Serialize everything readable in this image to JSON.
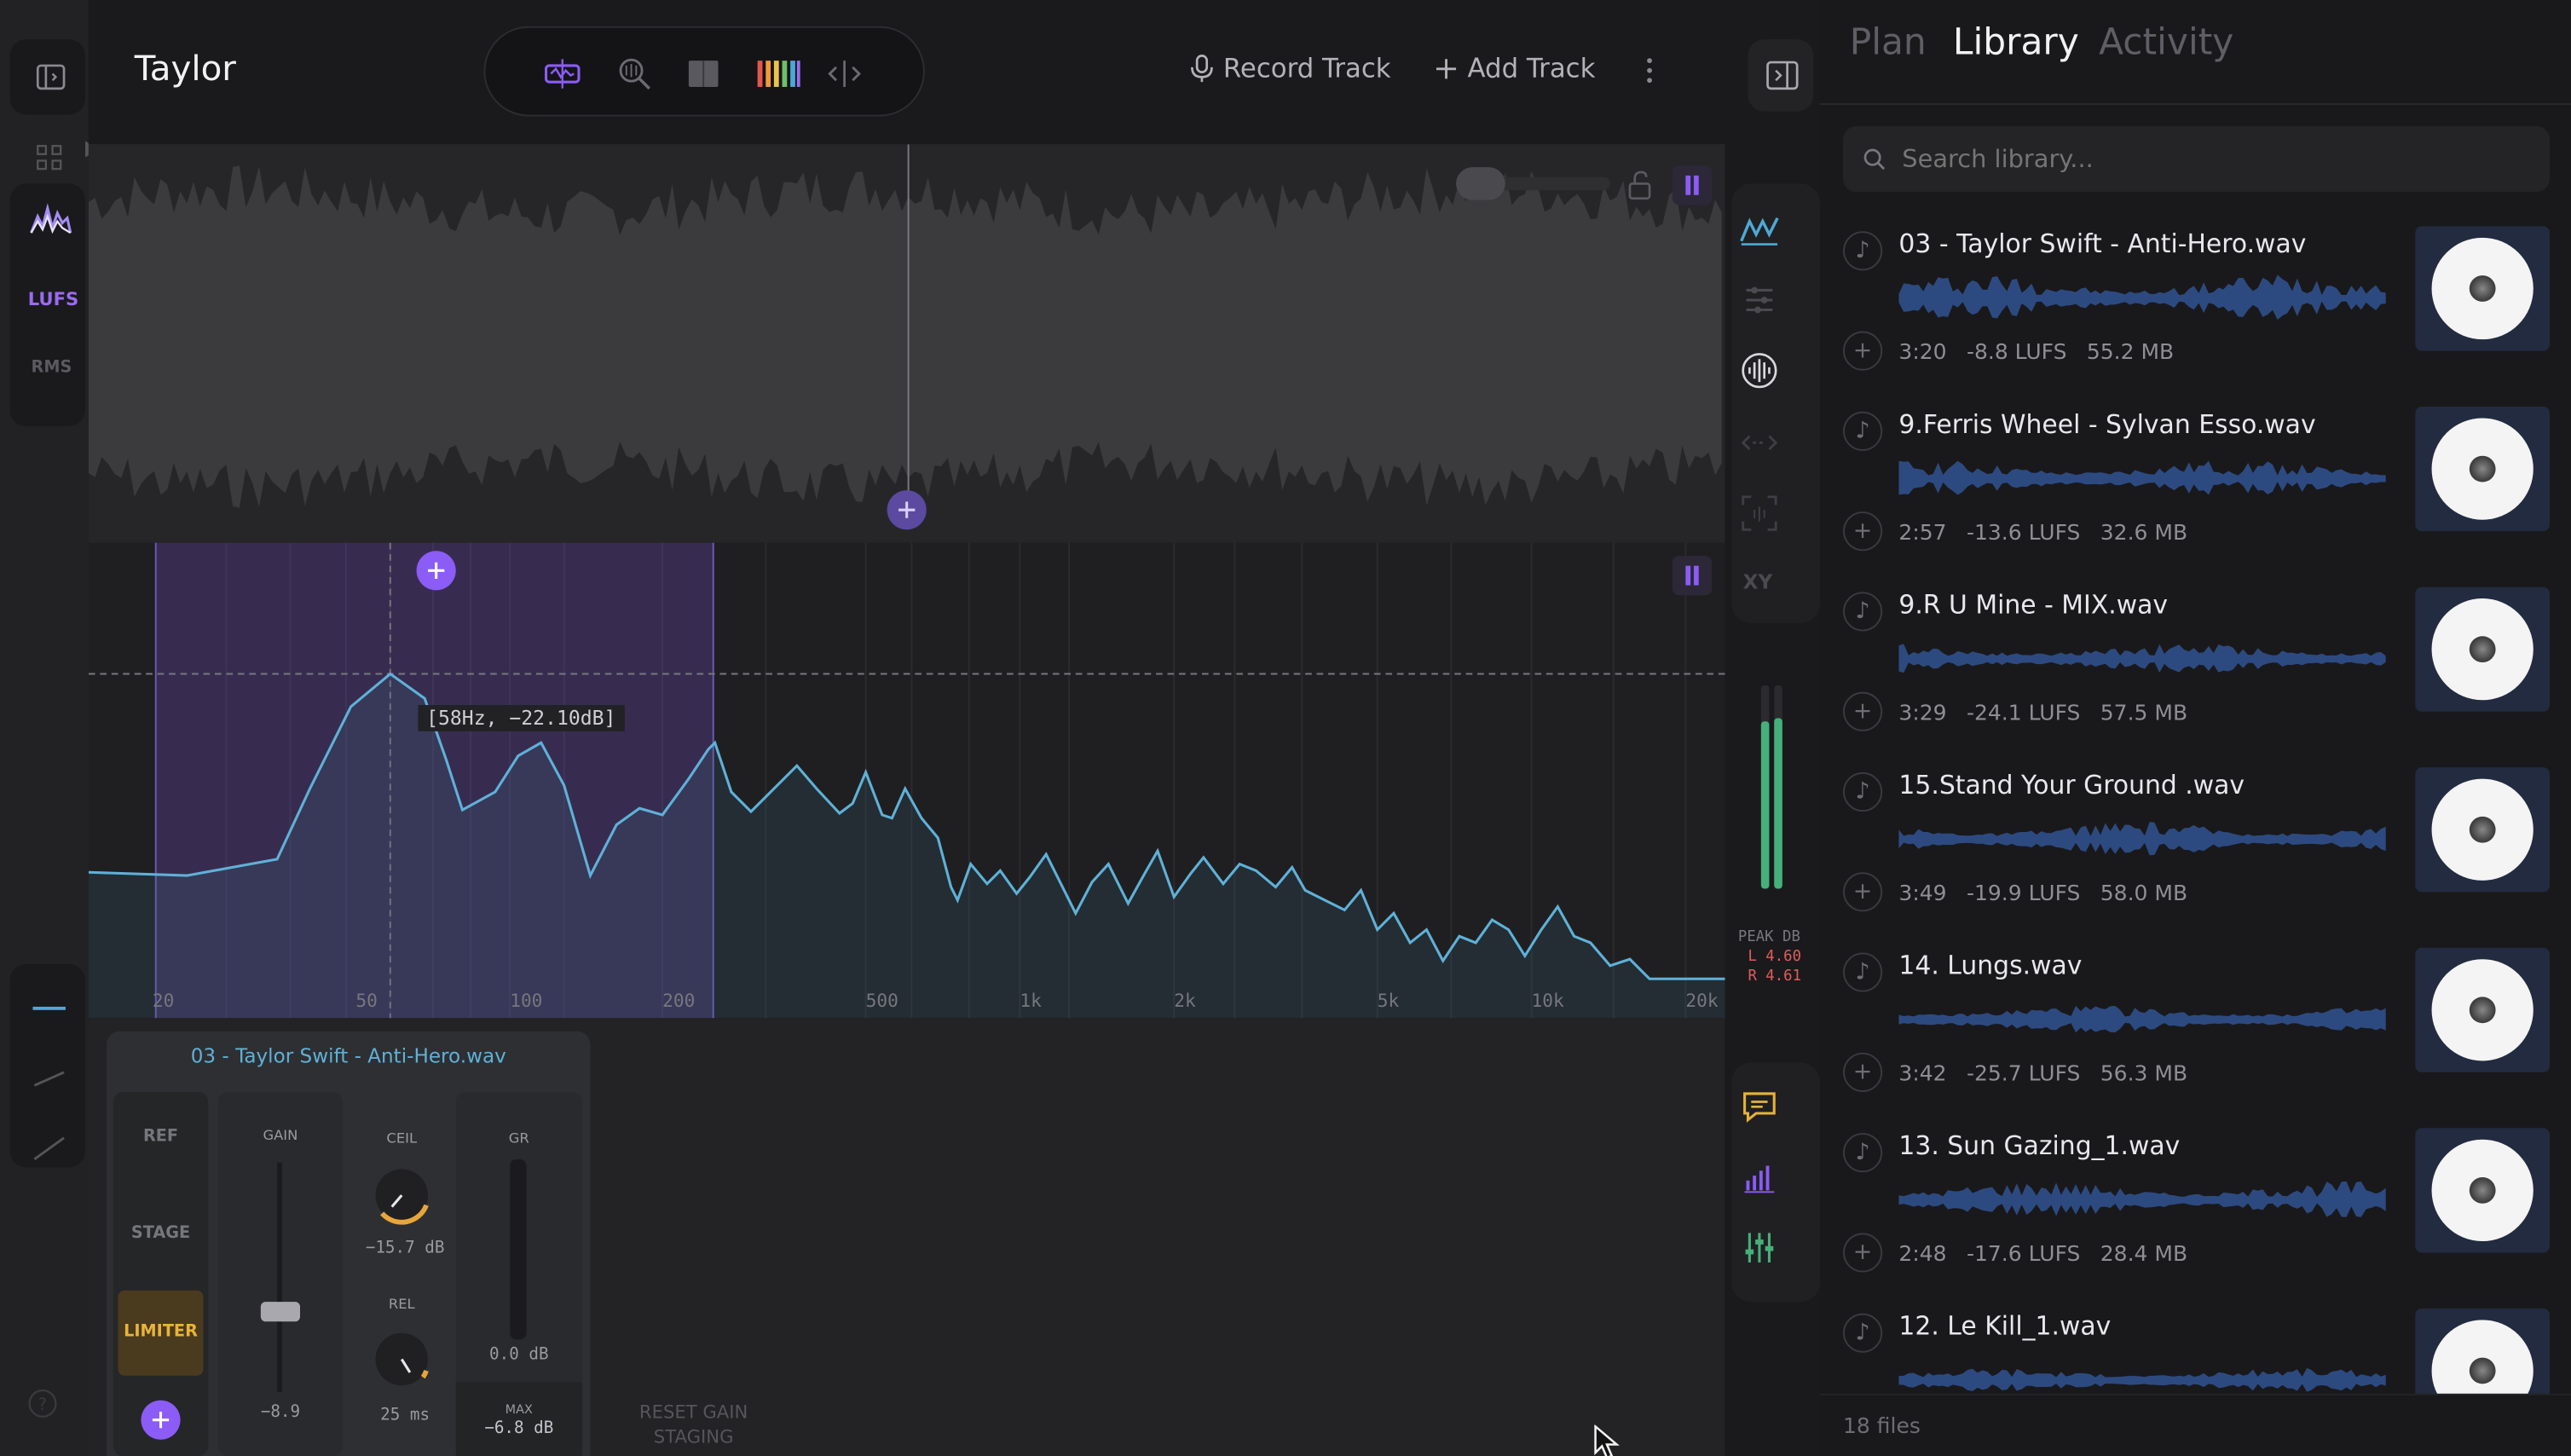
{
  "header": {
    "title": "Taylor",
    "record_label": "Record Track",
    "add_label": "Add Track"
  },
  "left_rail": {
    "lufs_label": "LUFS",
    "rms_label": "RMS"
  },
  "spectrum": {
    "tooltip": "[58Hz, −22.10dB]",
    "freq_labels": [
      "20",
      "50",
      "100",
      "200",
      "500",
      "1k",
      "2k",
      "5k",
      "10k",
      "20k"
    ]
  },
  "meter": {
    "peak_label": "PEAK DB",
    "left": "L 4.60",
    "right": "R 4.61",
    "xy_label": "XY"
  },
  "gain_panel": {
    "file": "03 - Taylor Swift - Anti-Hero.wav",
    "ref": "REF",
    "stage": "STAGE",
    "limiter": "LIMITER",
    "gain_label": "GAIN",
    "gain_value": "−8.9",
    "ceil_label": "CEIL",
    "ceil_value": "−15.7 dB",
    "rel_label": "REL",
    "rel_value": "25 ms",
    "gr_label": "GR",
    "gr_value": "0.0 dB",
    "max_label": "MAX",
    "max_value": "−6.8 dB",
    "reset_label_1": "RESET GAIN",
    "reset_label_2": "STAGING"
  },
  "library": {
    "tabs": [
      "Plan",
      "Library",
      "Activity"
    ],
    "active_tab": "Library",
    "search_placeholder": "Search library...",
    "footer": "18 files",
    "items": [
      {
        "name": "03 - Taylor Swift - Anti-Hero.wav",
        "duration": "3:20",
        "lufs": "-8.8 LUFS",
        "size": "55.2 MB"
      },
      {
        "name": "9.Ferris Wheel - Sylvan Esso.wav",
        "duration": "2:57",
        "lufs": "-13.6 LUFS",
        "size": "32.6 MB"
      },
      {
        "name": "9.R U Mine - MIX.wav",
        "duration": "3:29",
        "lufs": "-24.1 LUFS",
        "size": "57.5 MB"
      },
      {
        "name": "15.Stand Your Ground .wav",
        "duration": "3:49",
        "lufs": "-19.9 LUFS",
        "size": "58.0 MB"
      },
      {
        "name": "14. Lungs.wav",
        "duration": "3:42",
        "lufs": "-25.7 LUFS",
        "size": "56.3 MB"
      },
      {
        "name": "13. Sun Gazing_1.wav",
        "duration": "2:48",
        "lufs": "-17.6 LUFS",
        "size": "28.4 MB"
      },
      {
        "name": "12. Le Kill_1.wav",
        "duration": "",
        "lufs": "",
        "size": ""
      }
    ]
  },
  "colors": {
    "accent": "#8b5cf6",
    "spectrum_line": "#5fb1d8",
    "meter_green": "#46b07a",
    "limiter_yellow": "#e8b43a",
    "comment_yellow": "#e6b23a"
  }
}
